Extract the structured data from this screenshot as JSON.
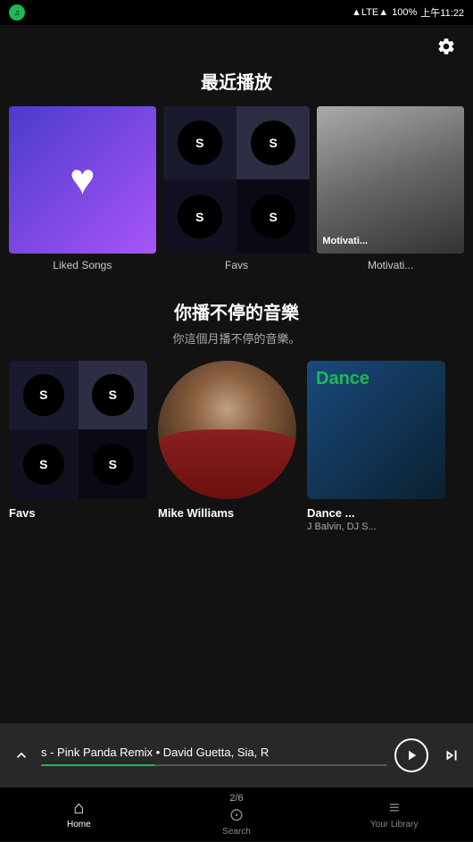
{
  "statusBar": {
    "carrier": "",
    "network": "LTE",
    "battery": "100%",
    "time": "上午11:22"
  },
  "header": {
    "settingsLabel": "⚙"
  },
  "recentSection": {
    "title": "最近播放",
    "items": [
      {
        "id": "liked-songs",
        "label": "Liked Songs",
        "type": "liked"
      },
      {
        "id": "favs",
        "label": "Favs",
        "type": "favs"
      },
      {
        "id": "motivation",
        "label": "Motivati...",
        "type": "motivation"
      }
    ]
  },
  "section2": {
    "title": "你播不停的音樂",
    "subtitle": "你這個月播不停的音樂。",
    "cards": [
      {
        "id": "favs2",
        "label": "Favs",
        "sublabel": "",
        "type": "favs"
      },
      {
        "id": "mike",
        "label": "Mike Williams",
        "sublabel": "",
        "type": "person"
      },
      {
        "id": "dance",
        "label": "Dance ...",
        "sublabel": "J Balvin, DJ S...",
        "type": "dance"
      }
    ]
  },
  "nowPlaying": {
    "text": "s - Pink Panda Remix • David Guetta, Sia, R",
    "progressPercent": 33,
    "pageCounter": "2/6"
  },
  "bottomNav": {
    "items": [
      {
        "id": "home",
        "icon": "🏠",
        "label": "Home",
        "active": true
      },
      {
        "id": "search",
        "icon": "🔍",
        "label": "Search",
        "active": false
      },
      {
        "id": "library",
        "icon": "📚",
        "label": "Your Library",
        "active": false
      }
    ]
  }
}
